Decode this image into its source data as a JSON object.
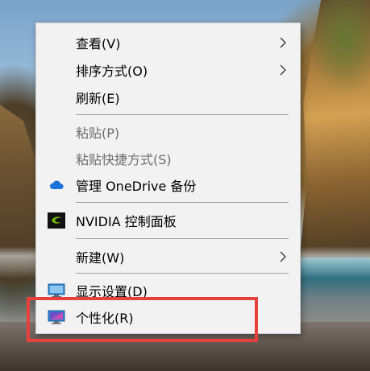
{
  "menu": {
    "view": "查看(V)",
    "sort": "排序方式(O)",
    "refresh": "刷新(E)",
    "paste": "粘贴(P)",
    "paste_shortcut": "粘贴快捷方式(S)",
    "onedrive": "管理 OneDrive 备份",
    "nvidia": "NVIDIA 控制面板",
    "new": "新建(W)",
    "display": "显示设置(D)",
    "personalize": "个性化(R)"
  },
  "colors": {
    "menu_bg": "#f2f2f2",
    "highlight_border": "#e8403d",
    "disabled_text": "#6d6d6d"
  },
  "icons": {
    "onedrive": "cloud-icon",
    "nvidia": "nvidia-logo-icon",
    "display": "monitor-icon",
    "personalize": "personalize-monitor-icon",
    "submenu": "chevron-right-icon"
  }
}
